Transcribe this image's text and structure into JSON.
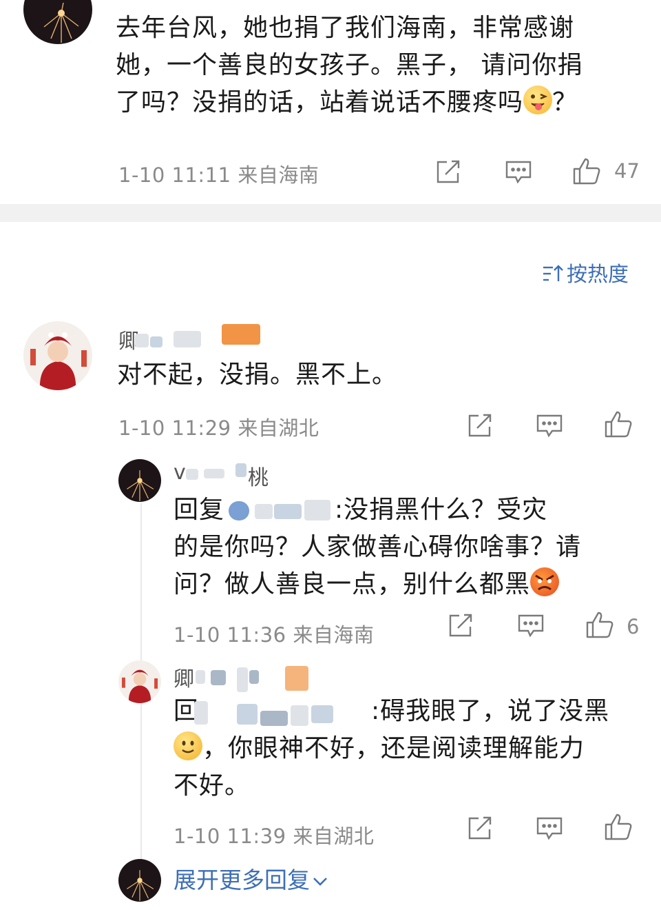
{
  "top_comment": {
    "text_line1": "去年台风，她也捐了我们海南，非常感谢",
    "text_line2": "她，一个善良的女孩子。黑子，  请问你捐",
    "text_line3a": "了吗？没捐的话，站着说话不腰疼吗",
    "text_line3b": "？",
    "meta": "1-10 11:11  来自海南",
    "like_count": "47"
  },
  "sort": {
    "icon": "sort-icon",
    "label": "按热度"
  },
  "comment1": {
    "name_visible": "卿",
    "text": "对不起，没捐。黑不上。",
    "meta": "1-10 11:29  来自湖北"
  },
  "reply1": {
    "name_prefix": "v",
    "name_suffix": "桃",
    "reply_prefix": "回复",
    "reply_suffix": ":没捐黑什么？受灾",
    "line2": "的是你吗？人家做善心碍你啥事？请",
    "line3": "问？做人善良一点，别什么都黑",
    "meta": "1-10 11:36  来自海南",
    "like_count": "6"
  },
  "reply2": {
    "name_visible": "卿",
    "reply_prefix": "回",
    "reply_suffix": ":碍我眼了，说了没黑",
    "line2": "，你眼神不好，还是阅读理解能力",
    "line3": "不好。",
    "meta": "1-10 11:39  来自湖北"
  },
  "expand": {
    "label": "展开更多回复",
    "icon": "chevron-down-icon"
  },
  "colors": {
    "link": "#3d6fb6",
    "meta": "#8a8a8a",
    "divider": "#f1f1f1"
  }
}
